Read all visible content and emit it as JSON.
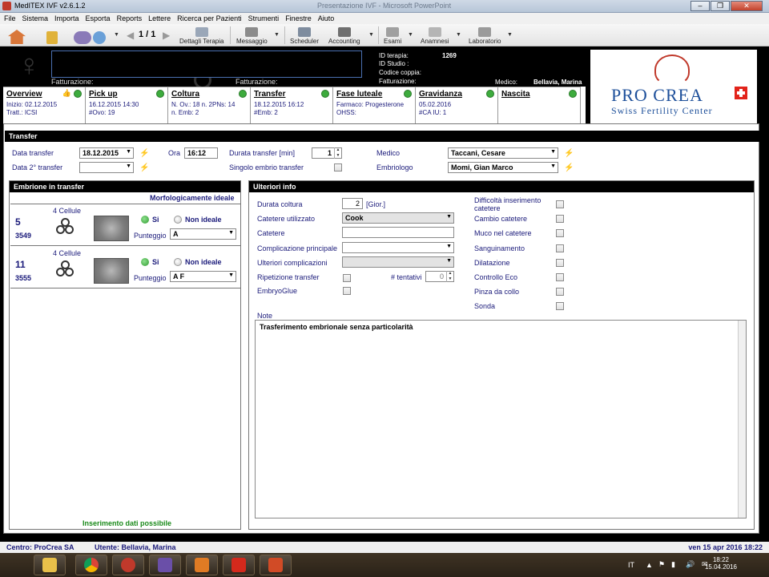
{
  "window": {
    "title": "MedITEX IVF v2.6.1.2",
    "ghost_title": "Presentazione IVF - Microsoft PowerPoint",
    "controls": [
      "–",
      "❐",
      "✕"
    ]
  },
  "menu": [
    "File",
    "Sistema",
    "Importa",
    "Esporta",
    "Reports",
    "Lettere",
    "Ricerca per Pazienti",
    "Strumenti",
    "Finestre",
    "Aiuto"
  ],
  "toolbar": {
    "page_indicator": "1 / 1",
    "dettagli_terapia": "Dettagli Terapia",
    "messaggio": "Messaggio",
    "scheduler": "Scheduler",
    "accounting": "Accounting",
    "esami": "Esami",
    "anamnesi": "Anamnesi",
    "laboratorio": "Laboratorio"
  },
  "header": {
    "fatturazione_left": "Fatturazione:",
    "fatturazione_mid": "Fatturazione:",
    "id_terapia_label": "ID terapia:",
    "id_terapia_value": "1269",
    "id_studio_label": "ID Studio :",
    "codice_coppia_label": "Codice coppia:",
    "fatturazione_label": "Fatturazione:",
    "medico_label": "Medico:",
    "medico_value": "Bellavia, Marina"
  },
  "logo": {
    "line1": "PRO CREA",
    "line2": "Swiss Fertility Center"
  },
  "tabs": [
    {
      "name": "Overview",
      "l1": "Inizio:  02.12.2015",
      "l2": "Tratt.: ICSI"
    },
    {
      "name": "Pick up",
      "l1": "16.12.2015 14:30",
      "l2": "#Ovo: 19"
    },
    {
      "name": "Coltura",
      "l1": "N. Ov.: 18  n. 2PNs: 14",
      "l2": "n. Emb: 2"
    },
    {
      "name": "Transfer",
      "l1": "18.12.2015 16:12",
      "l2": "#Emb: 2"
    },
    {
      "name": "Fase luteale",
      "l1": "Farmaco: Progesterone",
      "l2": "OHSS:"
    },
    {
      "name": "Gravidanza",
      "l1": "05.02.2016",
      "l2": "#CA IU:  1"
    },
    {
      "name": "Nascita",
      "l1": "",
      "l2": ""
    }
  ],
  "transfer": {
    "section_title": "Transfer",
    "data_transfer_label": "Data transfer",
    "data_transfer_value": "18.12.2015",
    "ora_label": "Ora",
    "ora_value": "16:12",
    "durata_label": "Durata transfer [min]",
    "durata_value": "1",
    "medico_label": "Medico",
    "medico_value": "Taccani, Cesare",
    "data2_label": "Data 2° transfer",
    "singolo_label": "Singolo embrio transfer",
    "embriologo_label": "Embriologo",
    "embriologo_value": "Momi, Gian Marco"
  },
  "embryos": {
    "panel_title": "Embrione in transfer",
    "morph_label": "Morfologicamente ideale",
    "si_label": "Si",
    "non_ideale_label": "Non ideale",
    "punteggio_label": "Punteggio",
    "items": [
      {
        "num": "5",
        "id": "3549",
        "cells": "4 Cellule",
        "score": "A"
      },
      {
        "num": "11",
        "id": "3555",
        "cells": "4 Cellule",
        "score": "A F"
      }
    ],
    "footer": "Inserimento dati possibile"
  },
  "ulteriori": {
    "panel_title": "Ulteriori info",
    "durata_coltura_label": "Durata coltura",
    "durata_coltura_value": "2",
    "durata_coltura_unit": "[Gior.]",
    "catetere_utilizzato_label": "Catetere utilizzato",
    "catetere_utilizzato_value": "Cook",
    "catetere_label": "Catetere",
    "complicazione_label": "Complicazione principale",
    "ulteriori_compl_label": "Ulteriori complicazioni",
    "ripetizione_label": "Ripetizione transfer",
    "tentativi_label": "# tentativi",
    "tentativi_value": "0",
    "embryoglue_label": "EmbryoGlue",
    "right_checks": [
      "Difficoltà inserimento catetere",
      "Cambio catetere",
      "Muco nel catetere",
      "Sanguinamento",
      "Dilatazione",
      "Controllo Eco",
      "Pinza da collo",
      "Sonda"
    ],
    "note_label": "Note",
    "note_text": "Trasferimento embrionale senza particolarità"
  },
  "status": {
    "centro": "Centro: ProCrea SA",
    "utente": "Utente: Bellavia, Marina",
    "datetime": "ven 15 apr 2016 18:22"
  },
  "taskbar": {
    "lang": "IT",
    "time": "18:22",
    "date": "15.04.2016"
  },
  "colors": {
    "label_blue": "#1a1a7a",
    "ok_green": "#3dab3d",
    "footer_green": "#1a8a1a",
    "brand_blue": "#1d4f9a"
  }
}
